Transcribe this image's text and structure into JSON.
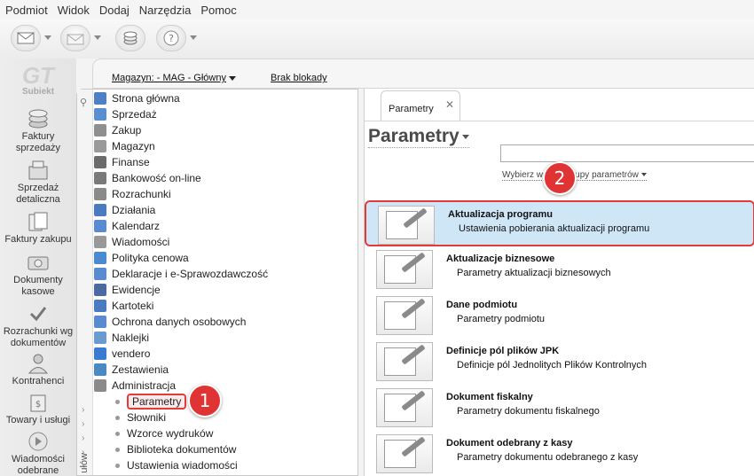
{
  "menu": [
    "Podmiot",
    "Widok",
    "Dodaj",
    "Narzędzia",
    "Pomoc"
  ],
  "app_logo": {
    "brand": "GT",
    "name": "Subiekt"
  },
  "rail": [
    {
      "label": "Faktury sprzedaży",
      "icon": "coins-icon"
    },
    {
      "label": "Sprzedaż detaliczna",
      "icon": "cash-register-icon"
    },
    {
      "label": "Faktury zakupu",
      "icon": "invoices-icon"
    },
    {
      "label": "Dokumenty kasowe",
      "icon": "cash-documents-icon"
    },
    {
      "label": "Rozrachunki wg dokumentów",
      "icon": "settlements-icon"
    },
    {
      "label": "Kontrahenci",
      "icon": "person-icon"
    },
    {
      "label": "Towary i usługi",
      "icon": "goods-icon"
    },
    {
      "label": "Wiadomości odebrane",
      "icon": "messages-icon"
    }
  ],
  "topstrip": {
    "magazyn": "Magazyn: - MAG - Główny",
    "blokada": "Brak blokady"
  },
  "tree_side_label": "ułów",
  "tree": [
    {
      "label": "Strona główna",
      "color": "#4f7fc4"
    },
    {
      "label": "Sprzedaż",
      "color": "#5b8ed0"
    },
    {
      "label": "Zakup",
      "color": "#8f8f8f"
    },
    {
      "label": "Magazyn",
      "color": "#9a9a9a"
    },
    {
      "label": "Finanse",
      "color": "#6b6b6b"
    },
    {
      "label": "Bankowość on-line",
      "color": "#7a7a7a"
    },
    {
      "label": "Rozrachunki",
      "color": "#8a8a8a"
    },
    {
      "label": "Działania",
      "color": "#4a7ac0"
    },
    {
      "label": "Kalendarz",
      "color": "#5a8ad0"
    },
    {
      "label": "Wiadomości",
      "color": "#999999"
    },
    {
      "label": "Polityka cenowa",
      "color": "#4a8ad0"
    },
    {
      "label": "Deklaracje i e-Sprawozdawczość",
      "color": "#5a8ad0"
    },
    {
      "label": "Ewidencje",
      "color": "#4a6aa0"
    },
    {
      "label": "Kartoteki",
      "color": "#4a7ac0"
    },
    {
      "label": "Ochrona danych osobowych",
      "color": "#5a8ad0"
    },
    {
      "label": "Naklejki",
      "color": "#6a9ad0"
    },
    {
      "label": "vendero",
      "color": "#3a7ad0"
    },
    {
      "label": "Zestawienia",
      "color": "#4a8ac0"
    },
    {
      "label": "Administracja",
      "color": "#8a8a8a"
    }
  ],
  "admin_sub": [
    "Parametry",
    "Słowniki",
    "Wzorce wydruków",
    "Biblioteka dokumentów",
    "Ustawienia wiadomości"
  ],
  "tab": {
    "label": "Parametry",
    "close": "✕"
  },
  "page_title": "Parametry",
  "search": {
    "value": "",
    "placeholder": ""
  },
  "group_link": "Wybierz według grupy parametrów",
  "items": [
    {
      "title": "Aktualizacja programu",
      "desc": "Ustawienia pobierania aktualizacji programu"
    },
    {
      "title": "Aktualizacje biznesowe",
      "desc": "Parametry aktualizacji biznesowych"
    },
    {
      "title": "Dane podmiotu",
      "desc": "Parametry podmiotu"
    },
    {
      "title": "Definicje pól plików JPK",
      "desc": "Definicje pól Jednolitych Plików Kontrolnych"
    },
    {
      "title": "Dokument fiskalny",
      "desc": "Parametry dokumentu fiskalnego"
    },
    {
      "title": "Dokument odebrany z kasy",
      "desc": "Parametry dokumentu odebranego z kasy"
    }
  ],
  "badges": [
    "1",
    "2"
  ],
  "colors": {
    "highlight_bg": "#cfe6f7",
    "annotation_red": "#e03434"
  }
}
